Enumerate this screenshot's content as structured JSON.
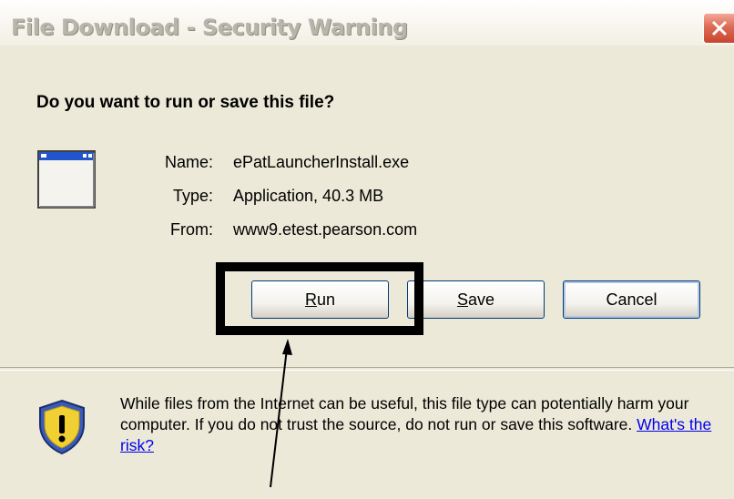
{
  "window": {
    "title": "File Download - Security Warning"
  },
  "dialog": {
    "question": "Do you want to run or save this file?",
    "fields": [
      {
        "key": "Name:",
        "value": "ePatLauncherInstall.exe"
      },
      {
        "key": "Type:",
        "value": "Application, 40.3 MB"
      },
      {
        "key": "From:",
        "value": "www9.etest.pearson.com"
      }
    ],
    "buttons": {
      "run": {
        "label_mnemonic": "R",
        "label_rest": "un"
      },
      "save": {
        "label_mnemonic": "S",
        "label_rest": "ave"
      },
      "cancel": {
        "label": "Cancel"
      }
    },
    "warning": {
      "text": "While files from the Internet can be useful, this file type can potentially harm your computer. If you do not trust the source, do not run or save this software.",
      "link": "What's the risk?"
    }
  },
  "icons": {
    "close": "close-icon",
    "app": "application-window-icon",
    "shield": "security-shield-warning-icon"
  },
  "colors": {
    "face": "#ece9d8",
    "close_red": "#dd6b55",
    "link": "#0000ee",
    "highlight": "#000000"
  }
}
